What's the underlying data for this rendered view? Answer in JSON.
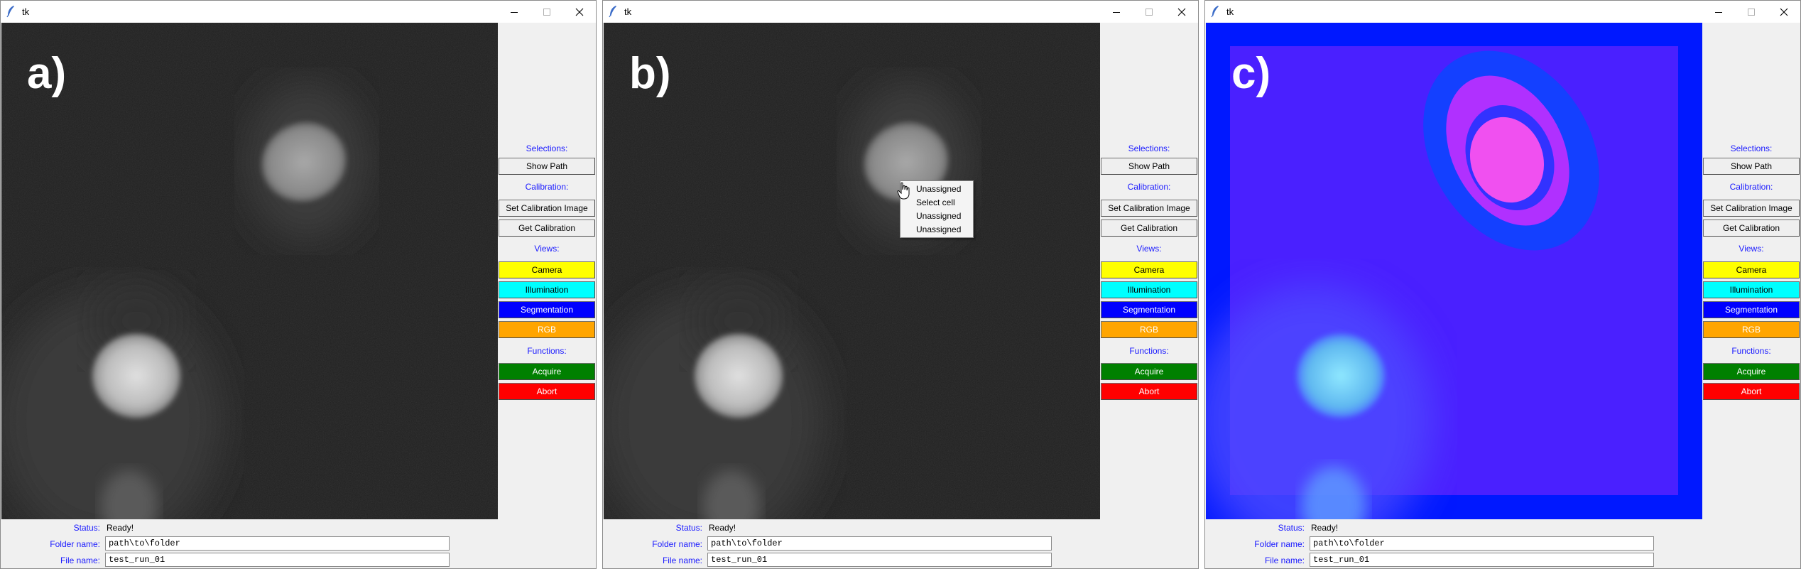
{
  "windows": [
    {
      "title": "tk",
      "panel_label": "a)",
      "view": "camera-grayscale",
      "sidebar": {
        "selections_label": "Selections:",
        "show_path": "Show Path",
        "calibration_label": "Calibration:",
        "set_calibration_image": "Set Calibration Image",
        "get_calibration": "Get Calibration",
        "views_label": "Views:",
        "camera": "Camera",
        "illumination": "Illumination",
        "segmentation": "Segmentation",
        "rgb": "RGB",
        "functions_label": "Functions:",
        "acquire": "Acquire",
        "abort": "Abort"
      },
      "status_label": "Status:",
      "status_value": "Ready!",
      "folder_label": "Folder name:",
      "folder_value": "path\\to\\folder",
      "file_label": "File name:",
      "file_value": "test_run_01"
    },
    {
      "title": "tk",
      "panel_label": "b)",
      "view": "camera-grayscale",
      "sidebar": {
        "selections_label": "Selections:",
        "show_path": "Show Path",
        "calibration_label": "Calibration:",
        "set_calibration_image": "Set Calibration Image",
        "get_calibration": "Get Calibration",
        "views_label": "Views:",
        "camera": "Camera",
        "illumination": "Illumination",
        "segmentation": "Segmentation",
        "rgb": "RGB",
        "functions_label": "Functions:",
        "acquire": "Acquire",
        "abort": "Abort"
      },
      "context_menu": [
        "Unassigned",
        "Select cell",
        "Unassigned",
        "Unassigned"
      ],
      "status_label": "Status:",
      "status_value": "Ready!",
      "folder_label": "Folder name:",
      "folder_value": "path\\to\\folder",
      "file_label": "File name:",
      "file_value": "test_run_01"
    },
    {
      "title": "tk",
      "panel_label": "c)",
      "view": "segmentation-overlay",
      "sidebar": {
        "selections_label": "Selections:",
        "show_path": "Show Path",
        "calibration_label": "Calibration:",
        "set_calibration_image": "Set Calibration Image",
        "get_calibration": "Get Calibration",
        "views_label": "Views:",
        "camera": "Camera",
        "illumination": "Illumination",
        "segmentation": "Segmentation",
        "rgb": "RGB",
        "functions_label": "Functions:",
        "acquire": "Acquire",
        "abort": "Abort"
      },
      "status_label": "Status:",
      "status_value": "Ready!",
      "folder_label": "Folder name:",
      "folder_value": "path\\to\\folder",
      "file_label": "File name:",
      "file_value": "test_run_01"
    }
  ],
  "colors": {
    "label_blue": "#1a1aff",
    "camera_button": "#ffff00",
    "illumination_button": "#00ffff",
    "segmentation_button": "#0000ff",
    "rgb_button": "#ffa500",
    "acquire_button": "#008000",
    "abort_button": "#ff0000"
  },
  "icons": [
    "tk-feather-icon",
    "minimize-icon",
    "maximize-icon",
    "close-icon",
    "hand-cursor-icon"
  ]
}
